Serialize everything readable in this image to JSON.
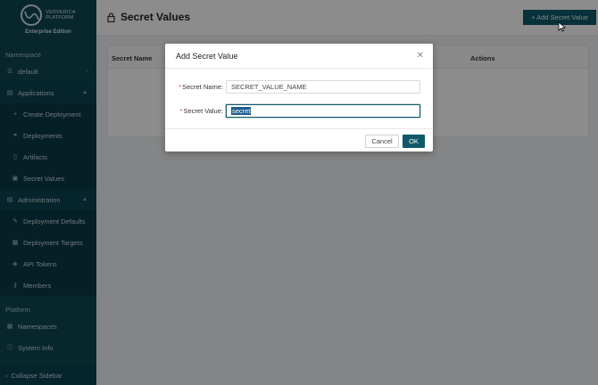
{
  "brand": {
    "line1": "VERVERICA",
    "line2": "PLATFORM",
    "edition": "Enterprise Edition"
  },
  "sidebar": {
    "namespace_label": "Namespace",
    "namespace_value": "default",
    "applications_label": "Applications",
    "applications_items": [
      {
        "label": "Create Deployment",
        "icon": "plus-icon"
      },
      {
        "label": "Deployments",
        "icon": "link-icon"
      },
      {
        "label": "Artifacts",
        "icon": "file-icon"
      },
      {
        "label": "Secret Values",
        "icon": "lock-icon"
      }
    ],
    "administration_label": "Administration",
    "administration_items": [
      {
        "label": "Deployment Defaults",
        "icon": "edit-icon"
      },
      {
        "label": "Deployment Targets",
        "icon": "target-icon"
      },
      {
        "label": "API Tokens",
        "icon": "tag-icon"
      },
      {
        "label": "Members",
        "icon": "key-icon"
      }
    ],
    "platform_label": "Platform",
    "platform_items": [
      {
        "label": "Namespaces",
        "icon": "grid-icon"
      },
      {
        "label": "System Info",
        "icon": "info-icon"
      }
    ],
    "collapse_label": "Collapse Sidebar"
  },
  "header": {
    "title": "Secret Values",
    "add_button": "+ Add Secret Value"
  },
  "table": {
    "col_name": "Secret Name",
    "col_actions": "Actions"
  },
  "modal": {
    "title": "Add Secret Value",
    "name_label": "Secret Name",
    "name_value": "SECRET_VALUE_NAME",
    "value_label": "Secret Value",
    "value_value": "secret",
    "cancel": "Cancel",
    "ok": "OK"
  },
  "colors": {
    "sidebar_bg": "#0e4753",
    "accent": "#10596a"
  }
}
